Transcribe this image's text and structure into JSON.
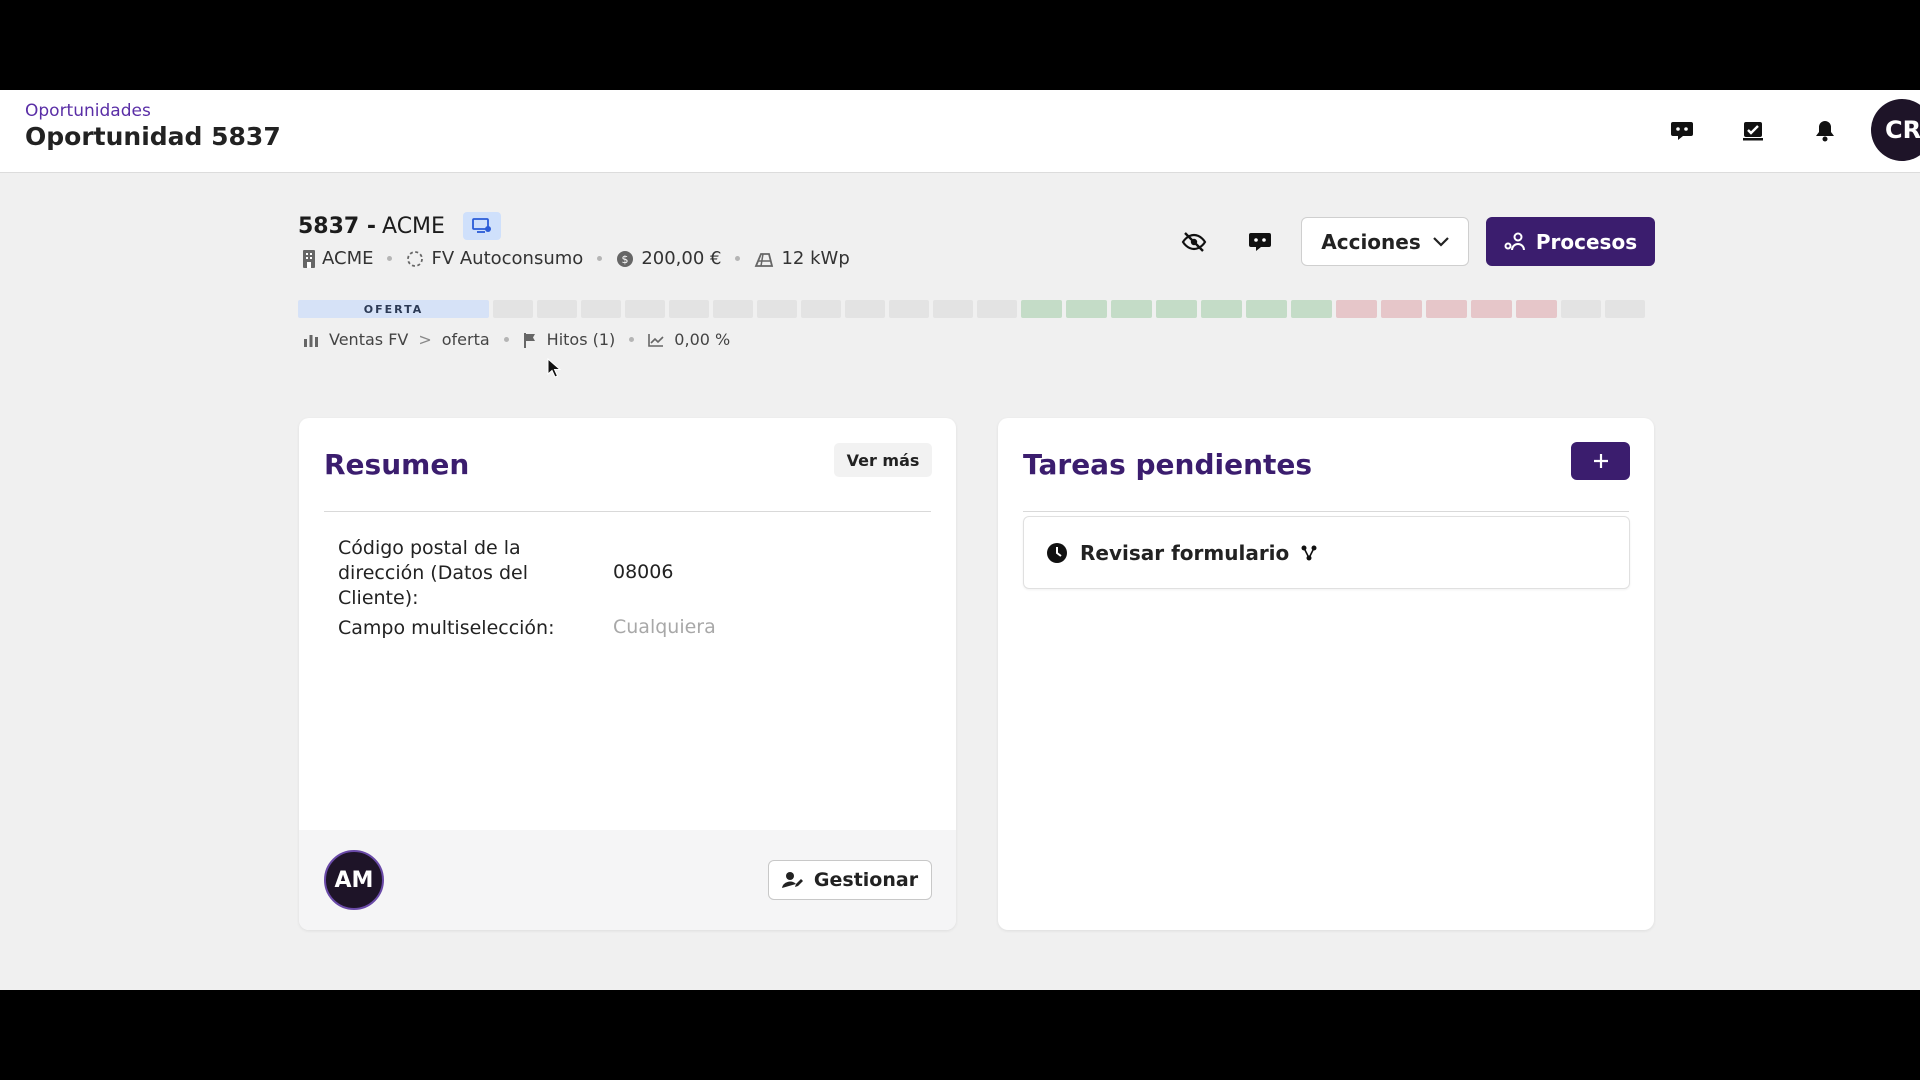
{
  "topbar": {
    "breadcrumb": "Oportunidades",
    "title": "Oportunidad 5837",
    "avatar_initials": "CR"
  },
  "opportunity": {
    "number": "5837 -",
    "client": "ACME",
    "meta": {
      "company": "ACME",
      "type": "FV Autoconsumo",
      "amount": "200,00 €",
      "power": "12 kWp"
    },
    "actions_label": "Acciones",
    "processes_label": "Procesos"
  },
  "stages": {
    "active_label": "OFERTA",
    "colors": {
      "active": "#d6e2f7",
      "gray": "#e3e3e3",
      "green": "#c4dcc7",
      "red": "#e6c6c9"
    }
  },
  "subinfo": {
    "pipeline": "Ventas FV",
    "separator": ">",
    "stage": "oferta",
    "milestones": "Hitos (1)",
    "percent": "0,00 %"
  },
  "summary": {
    "title": "Resumen",
    "see_more": "Ver más",
    "fields": [
      {
        "label": "Código postal de la dirección (Datos del Cliente):",
        "value": "08006"
      },
      {
        "label": "Campo multiselección:",
        "value": "Cualquiera"
      }
    ],
    "avatar_initials": "AM",
    "manage_label": "Gestionar"
  },
  "tasks": {
    "title": "Tareas pendientes",
    "items": [
      {
        "label": "Revisar formulario"
      }
    ]
  },
  "colors": {
    "brand": "#3b1d6e",
    "accent_text": "#5a2ea6"
  }
}
